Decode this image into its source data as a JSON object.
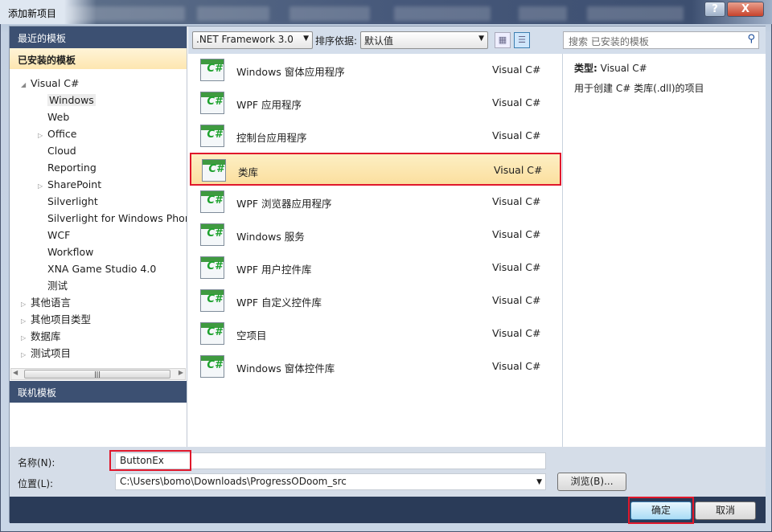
{
  "window": {
    "title": "添加新项目",
    "help": "?",
    "close": "X"
  },
  "sidebar": {
    "recent": "最近的模板",
    "installed": "已安装的模板",
    "online": "联机模板",
    "tree": [
      {
        "label": "Visual C#",
        "level": 0,
        "expander": "expanded"
      },
      {
        "label": "Windows",
        "level": 1,
        "expander": "none",
        "selected": true
      },
      {
        "label": "Web",
        "level": 1,
        "expander": "none"
      },
      {
        "label": "Office",
        "level": 1,
        "expander": "collapsed"
      },
      {
        "label": "Cloud",
        "level": 1,
        "expander": "none"
      },
      {
        "label": "Reporting",
        "level": 1,
        "expander": "none"
      },
      {
        "label": "SharePoint",
        "level": 1,
        "expander": "collapsed"
      },
      {
        "label": "Silverlight",
        "level": 1,
        "expander": "none"
      },
      {
        "label": "Silverlight for Windows Phone",
        "level": 1,
        "expander": "none"
      },
      {
        "label": "WCF",
        "level": 1,
        "expander": "none"
      },
      {
        "label": "Workflow",
        "level": 1,
        "expander": "none"
      },
      {
        "label": "XNA Game Studio 4.0",
        "level": 1,
        "expander": "none"
      },
      {
        "label": "测试",
        "level": 1,
        "expander": "none"
      },
      {
        "label": "其他语言",
        "level": 0,
        "expander": "collapsed"
      },
      {
        "label": "其他项目类型",
        "level": 0,
        "expander": "collapsed"
      },
      {
        "label": "数据库",
        "level": 0,
        "expander": "collapsed"
      },
      {
        "label": "测试项目",
        "level": 0,
        "expander": "collapsed"
      }
    ]
  },
  "toolbar": {
    "framework": ".NET Framework 3.0",
    "sort_label": "排序依据:",
    "sort_value": "默认值",
    "search_placeholder": "搜索 已安装的模板"
  },
  "templates": [
    {
      "name": "Windows 窗体应用程序",
      "lang": "Visual C#",
      "icon": "winforms-app-icon"
    },
    {
      "name": "WPF 应用程序",
      "lang": "Visual C#",
      "icon": "wpf-app-icon"
    },
    {
      "name": "控制台应用程序",
      "lang": "Visual C#",
      "icon": "console-app-icon"
    },
    {
      "name": "类库",
      "lang": "Visual C#",
      "icon": "class-library-icon",
      "selected": true
    },
    {
      "name": "WPF 浏览器应用程序",
      "lang": "Visual C#",
      "icon": "wpf-browser-app-icon"
    },
    {
      "name": "Windows 服务",
      "lang": "Visual C#",
      "icon": "windows-service-icon"
    },
    {
      "name": "WPF 用户控件库",
      "lang": "Visual C#",
      "icon": "wpf-user-control-icon"
    },
    {
      "name": "WPF 自定义控件库",
      "lang": "Visual C#",
      "icon": "wpf-custom-control-icon"
    },
    {
      "name": "空项目",
      "lang": "Visual C#",
      "icon": "empty-project-icon"
    },
    {
      "name": "Windows 窗体控件库",
      "lang": "Visual C#",
      "icon": "winforms-control-library-icon"
    }
  ],
  "detail": {
    "type_label": "类型:",
    "type_value": "Visual C#",
    "description": "用于创建 C# 类库(.dll)的项目"
  },
  "form": {
    "name_label": "名称(N):",
    "name_value": "ButtonEx",
    "location_label": "位置(L):",
    "location_value": "C:\\Users\\bomo\\Downloads\\ProgressODoom_src",
    "browse": "浏览(B)..."
  },
  "buttons": {
    "ok": "确定",
    "cancel": "取消"
  },
  "colors": {
    "highlight": "#e0182c",
    "nav_header": "#3c5072",
    "bottom_bar": "#2a3b58"
  }
}
